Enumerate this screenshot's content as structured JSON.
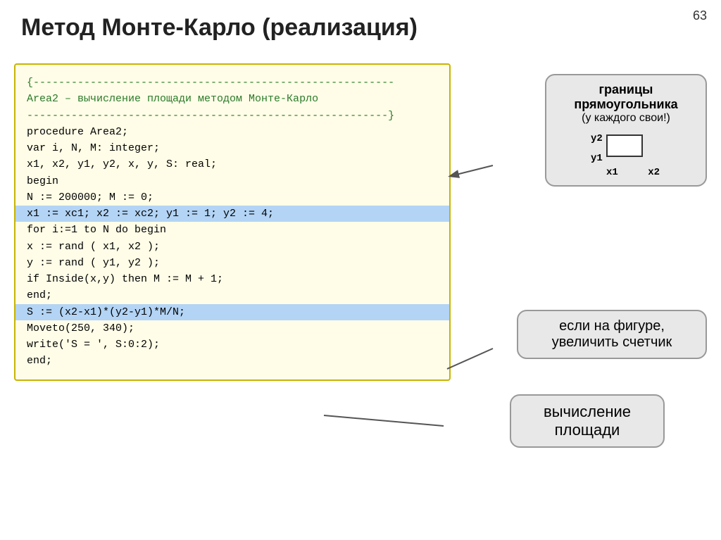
{
  "page": {
    "number": "63",
    "title": "Метод Монте-Карло (реализация)"
  },
  "code": {
    "comment1": "{---------------------------------------------------------",
    "comment2": "  Area2 – вычисление площади методом Монте-Карло",
    "comment3": "---------------------------------------------------------}",
    "line1": "procedure Area2;",
    "line2": "var i, N, M: integer;",
    "line3": "    x1, x2, y1, y2, x, y, S: real;",
    "line4": "begin",
    "line5": "  N := 200000;   M := 0;",
    "line6_highlight": "  x1 := xc1;  x2 := xc2; y1 := 1;  y2 := 4;",
    "line7": "  for i:=1 to N do begin",
    "line8": "    x  :=  rand  (  x1,  x2  );",
    "line9": "    y  :=  rand  (  y1,  y2  );",
    "line10": "    if Inside(x,y) then   M  :=  M  +  1;",
    "line11": "  end;",
    "line12_highlight": "  S  :=  (x2-x1)*(y2-y1)*M/N;",
    "line13": "  Moveto(250, 340);",
    "line14": "  write('S = ', S:0:2);",
    "line15": "end;"
  },
  "callouts": {
    "top": {
      "line1": "границы",
      "line2": "прямоугольника",
      "line3": "(у каждого свои!)"
    },
    "middle": {
      "line1": "если на фигуре,",
      "line2": "увеличить счетчик"
    },
    "bottom": {
      "line1": "вычисление",
      "line2": "площади"
    }
  },
  "diagram": {
    "y2": "y2",
    "y1": "y1",
    "x1": "x1",
    "x2": "x2"
  }
}
